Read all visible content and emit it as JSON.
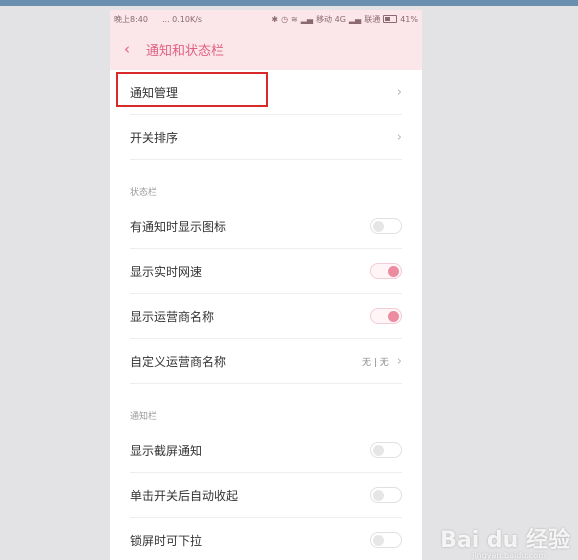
{
  "status_bar": {
    "time": "晚上8:40",
    "network_speed": "... 0.10K/s",
    "carrier1": "移动 4G",
    "carrier2": "联通",
    "battery": "41%"
  },
  "header": {
    "back_icon": "‹",
    "title": "通知和状态栏"
  },
  "rows_top": [
    {
      "label": "通知管理"
    },
    {
      "label": "开关排序"
    }
  ],
  "section_status": "状态栏",
  "status_items": [
    {
      "label": "有通知时显示图标",
      "on": false
    },
    {
      "label": "显示实时网速",
      "on": true
    },
    {
      "label": "显示运营商名称",
      "on": true
    }
  ],
  "custom_carrier": {
    "label": "自定义运营商名称",
    "value": "无 | 无"
  },
  "section_notification": "通知栏",
  "notification_items": [
    {
      "label": "显示截屏通知",
      "on": false
    },
    {
      "label": "单击开关后自动收起",
      "on": false
    },
    {
      "label": "锁屏时可下拉",
      "on": false
    }
  ],
  "chevron": "›",
  "watermark": {
    "brand": "Bai du 经验",
    "url": "jingyan.baidu.com"
  },
  "colors": {
    "accent": "#e06080",
    "toggle_on": "#ec8ca1",
    "highlight": "#d82a2a"
  }
}
